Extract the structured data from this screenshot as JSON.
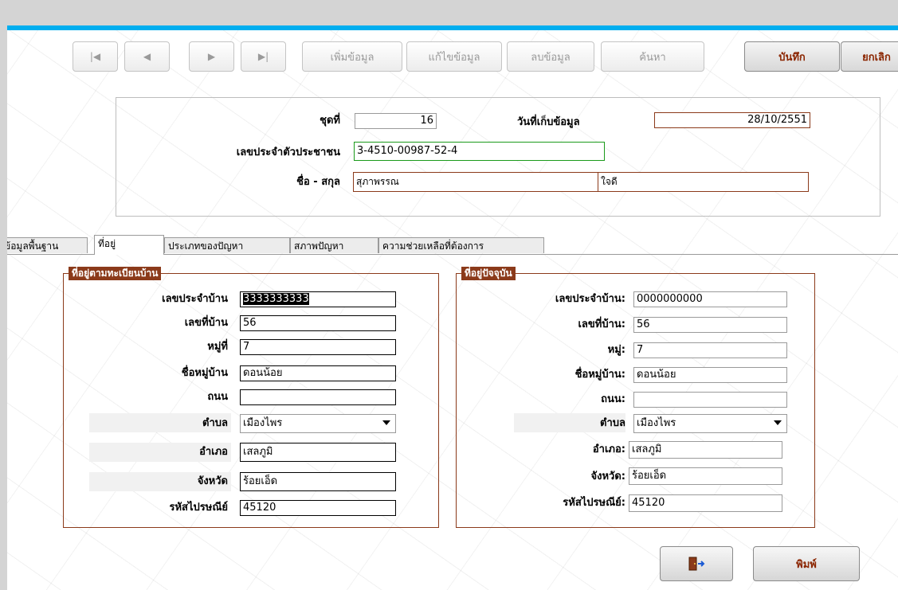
{
  "colors": {
    "accent": "#00aeef",
    "brand_text": "#8b2500",
    "group_border": "#8b3a1a"
  },
  "toolbar": {
    "nav": [
      {
        "name": "first-record-button",
        "glyph": "|◀"
      },
      {
        "name": "prev-record-button",
        "glyph": "◀"
      },
      {
        "name": "next-record-button",
        "glyph": "▶"
      },
      {
        "name": "last-record-button",
        "glyph": "▶|"
      }
    ],
    "add_label": "เพิ่มข้อมูล",
    "edit_label": "แก้ไขข้อมูล",
    "delete_label": "ลบข้อมูล",
    "search_label": "ค้นหา",
    "save_label": "บันทึก",
    "cancel_label": "ยกเลิก"
  },
  "header": {
    "set_label": "ชุดที่",
    "set_value": "16",
    "date_label": "วันที่เก็บข้อมูล",
    "date_value": "28/10/2551",
    "id_label": "เลขประจำตัวประชาชน",
    "id_value": "3-4510-00987-52-4",
    "name_label": "ชื่อ - สกุล",
    "first_name": "สุภาพรรณ",
    "last_name": "ใจดี"
  },
  "tabs": [
    "ข้อมูลพื้นฐาน",
    "ที่อยู่",
    "ประเภทของปัญหา",
    "สภาพปัญหา",
    "ความช่วยเหลือที่ต้องการ"
  ],
  "registered_address": {
    "title": "ที่อยู่ตามทะเบียนบ้าน",
    "house_id_label": "เลขประจำบ้าน",
    "house_id": "3333333333",
    "house_no_label": "เลขที่บ้าน",
    "house_no": "56",
    "moo_label": "หมู่ที่",
    "moo": "7",
    "village_label": "ชื่อหมู่บ้าน",
    "village": "ดอนน้อย",
    "road_label": "ถนน",
    "road": "",
    "subdistrict_label": "ตำบล",
    "subdistrict": "เมืองไพร",
    "district_label": "อำเภอ",
    "district": "เสลภูมิ",
    "province_label": "จังหวัด",
    "province": "ร้อยเอ็ด",
    "postal_label": "รหัสไปรษณีย์",
    "postal": "45120"
  },
  "current_address": {
    "title": "ที่อยู่ปัจจุบัน",
    "house_id_label": "เลขประจำบ้าน:",
    "house_id": "0000000000",
    "house_no_label": "เลขที่บ้าน:",
    "house_no": "56",
    "moo_label": "หมู่:",
    "moo": "7",
    "village_label": "ชื่อหมู่บ้าน:",
    "village": "ดอนน้อย",
    "road_label": "ถนน:",
    "road": "",
    "subdistrict_label": "ตำบล",
    "subdistrict": "เมืองไพร",
    "district_label": "อำเภอ:",
    "district": "เสลภูมิ",
    "province_label": "จังหวัด:",
    "province": "ร้อยเอ็ด",
    "postal_label": "รหัสไปรษณีย์:",
    "postal": "45120"
  },
  "footer": {
    "exit_icon": "exit-door-icon",
    "print_label": "พิมพ์"
  }
}
